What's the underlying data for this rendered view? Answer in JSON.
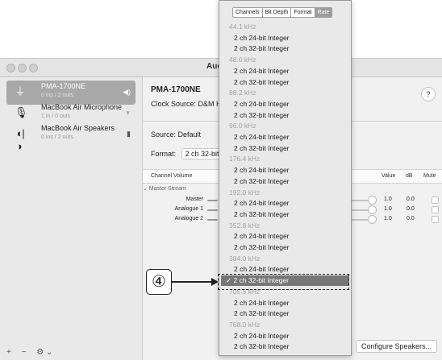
{
  "window": {
    "title": "Aud"
  },
  "sidebar": {
    "devices": [
      {
        "name": "PMA-1700NE",
        "sub": "0 ins / 2 outs",
        "icon": "usb-icon",
        "badge": "◀)",
        "selected": true
      },
      {
        "name": "MacBook Air Microphone",
        "sub": "1 in / 0 outs",
        "icon": "microphone-icon",
        "badge": "🎙",
        "selected": false
      },
      {
        "name": "MacBook Air Speakers",
        "sub": "0 ins / 2 outs",
        "icon": "speaker-icon",
        "badge": "▮",
        "selected": false
      }
    ],
    "tools": {
      "add": "+",
      "remove": "−",
      "gear": "⚙ ⌄"
    }
  },
  "main": {
    "device_title": "PMA-1700NE",
    "clock_source": "Clock Source:  D&M H",
    "help": "?",
    "source": "Source:  Default",
    "format_label": "Format:",
    "format_value": "2 ch 32-bit",
    "columns": {
      "channel_volume": "Channel Volume",
      "value": "Value",
      "db": "dB",
      "mute": "Mute"
    },
    "stream": "⌄ Master Stream",
    "channels": [
      {
        "label": "Master",
        "value": "1.0",
        "db": "0.0"
      },
      {
        "label": "Analogue 1",
        "value": "1.0",
        "db": "0.0"
      },
      {
        "label": "Analogue 2",
        "value": "1.0",
        "db": "0.0"
      }
    ],
    "configure": "Configure Speakers..."
  },
  "dropdown": {
    "tabs": [
      "Channels",
      "Bit Depth",
      "Format",
      "Rate"
    ],
    "active_tab": "Rate",
    "groups": [
      {
        "rate": "44.1 kHz",
        "options": [
          "2 ch 24-bit Integer",
          "2 ch 32-bit Integer"
        ]
      },
      {
        "rate": "48.0 kHz",
        "options": [
          "2 ch 24-bit Integer",
          "2 ch 32-bit Integer"
        ]
      },
      {
        "rate": "88.2 kHz",
        "options": [
          "2 ch 24-bit Integer",
          "2 ch 32-bit Integer"
        ]
      },
      {
        "rate": "96.0 kHz",
        "options": [
          "2 ch 24-bit Integer",
          "2 ch 32-bit Integer"
        ]
      },
      {
        "rate": "176.4 kHz",
        "options": [
          "2 ch 24-bit Integer",
          "2 ch 32-bit Integer"
        ]
      },
      {
        "rate": "192.0 kHz",
        "options": [
          "2 ch 24-bit Integer",
          "2 ch 32-bit Integer"
        ]
      },
      {
        "rate": "352.8 kHz",
        "options": [
          "2 ch 24-bit Integer",
          "2 ch 32-bit Integer"
        ]
      },
      {
        "rate": "384.0 kHz",
        "options": [
          "2 ch 24-bit Integer",
          "✓ 2 ch 32-bit Integer"
        ]
      },
      {
        "rate": "705.6 kHz",
        "options": [
          "2 ch 24-bit Integer",
          "2 ch 32-bit Integer"
        ]
      },
      {
        "rate": "768.0 kHz",
        "options": [
          "2 ch 24-bit Integer",
          "2 ch 32-bit Integer"
        ]
      }
    ],
    "checked_option": "✓ 2 ch 32-bit Integer"
  },
  "callout": {
    "number": "④"
  },
  "colors": {
    "selected_row": "#a8a8a8",
    "checked_item": "#777777",
    "rate_header": "#a4a4a4"
  }
}
